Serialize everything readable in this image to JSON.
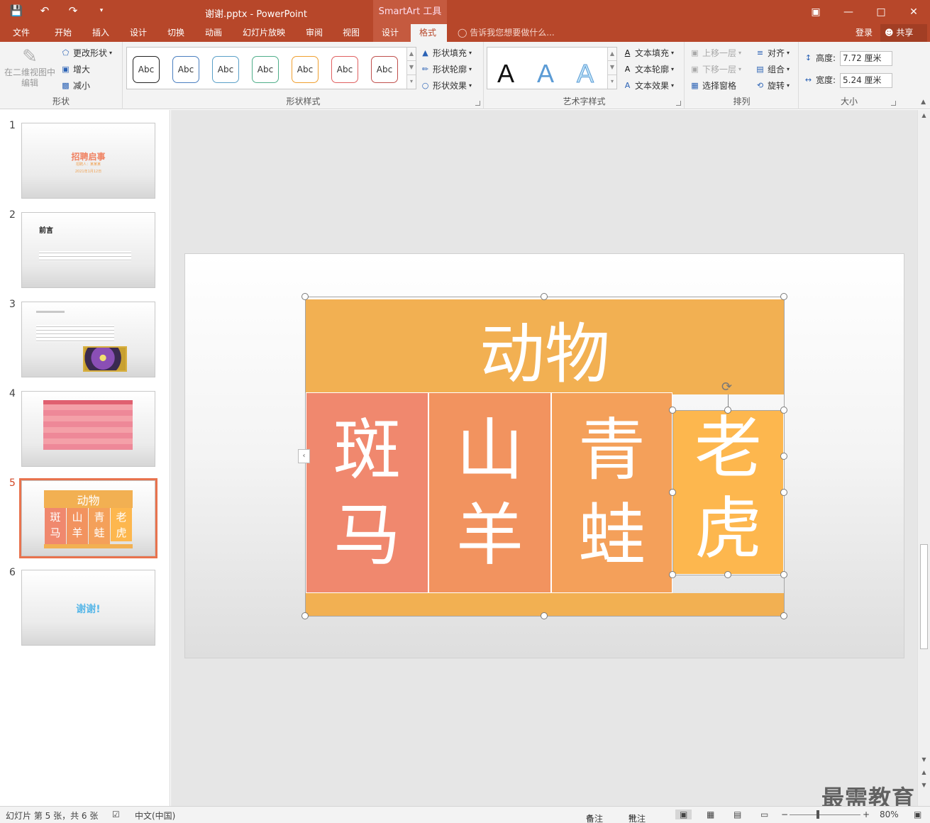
{
  "window": {
    "title": "谢谢.pptx - PowerPoint",
    "context_tab_group": "SmartArt 工具",
    "quick_access": [
      "save-icon",
      "undo-icon",
      "redo-icon",
      "customize-icon"
    ]
  },
  "tabs": {
    "file": "文件",
    "home": "开始",
    "insert": "插入",
    "design": "设计",
    "transitions": "切换",
    "animations": "动画",
    "slideshow": "幻灯片放映",
    "review": "审阅",
    "view": "视图",
    "sa_design": "设计",
    "sa_format": "格式",
    "tell_me": "告诉我您想要做什么...",
    "login": "登录",
    "share": "共享"
  },
  "ribbon": {
    "shapes": {
      "edit_2d": "在二维视图中编辑",
      "change_shape": "更改形状",
      "larger": "增大",
      "smaller": "减小",
      "label": "形状"
    },
    "shape_styles": {
      "label": "形状样式",
      "gallery_text": "Abc",
      "gallery_colors": [
        "#222222",
        "#4a7fc0",
        "#5aa0c8",
        "#4fae8a",
        "#f0a030",
        "#e06060",
        "#c0504d"
      ],
      "fill": "形状填充",
      "outline": "形状轮廓",
      "effects": "形状效果"
    },
    "wordart": {
      "label": "艺术字样式",
      "samples": [
        "A",
        "A",
        "A"
      ],
      "text_fill": "文本填充",
      "text_outline": "文本轮廓",
      "text_effects": "文本效果"
    },
    "arrange": {
      "label": "排列",
      "bring_forward": "上移一层",
      "send_backward": "下移一层",
      "selection_pane": "选择窗格",
      "align": "对齐",
      "group": "组合",
      "rotate": "旋转"
    },
    "size": {
      "label": "大小",
      "height_label": "高度:",
      "height_value": "7.72 厘米",
      "width_label": "宽度:",
      "width_value": "5.24 厘米"
    }
  },
  "thumbnails": [
    {
      "num": "1",
      "title": "招聘启事",
      "sub1": "招聘人：某某某",
      "sub2": "2021年1月12日"
    },
    {
      "num": "2",
      "title": "前言"
    },
    {
      "num": "3",
      "title": ""
    },
    {
      "num": "4",
      "title": ""
    },
    {
      "num": "5",
      "title": "动物",
      "items": [
        "斑马",
        "山羊",
        "青蛙",
        "老虎"
      ]
    },
    {
      "num": "6",
      "title": "谢谢!"
    }
  ],
  "slide": {
    "title": "动物",
    "children": [
      {
        "line1": "斑",
        "line2": "马",
        "color": "#f0886e"
      },
      {
        "line1": "山",
        "line2": "羊",
        "color": "#f2935f"
      },
      {
        "line1": "青",
        "line2": "蛙",
        "color": "#f4a05a"
      },
      {
        "line1": "老",
        "line2": "虎",
        "color": "#fdb74e"
      }
    ],
    "header_color": "#f2b052"
  },
  "status": {
    "slide_info": "幻灯片 第 5 张，共 6 张",
    "language": "中文(中国)",
    "notes": "备注",
    "comments": "批注",
    "zoom": "80%"
  },
  "watermark": "最需教育"
}
